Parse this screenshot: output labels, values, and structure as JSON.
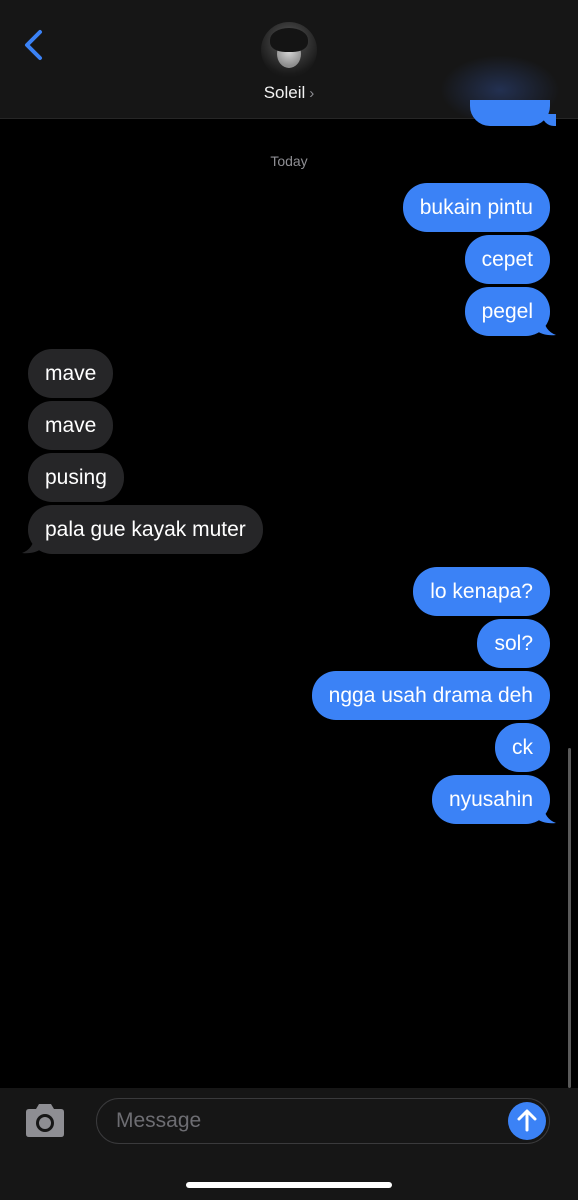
{
  "header": {
    "contact_name": "Soleil",
    "chevron": "›",
    "back_icon": "chevron-left-icon",
    "accent": "#3b82f6"
  },
  "thread": {
    "date_label": "Today",
    "messages": [
      {
        "direction": "sent",
        "text": "bukain pintu"
      },
      {
        "direction": "sent",
        "text": "cepet"
      },
      {
        "direction": "sent",
        "text": "pegel"
      },
      {
        "direction": "received",
        "text": "mave"
      },
      {
        "direction": "received",
        "text": "mave"
      },
      {
        "direction": "received",
        "text": "pusing"
      },
      {
        "direction": "received",
        "text": "pala gue kayak muter"
      },
      {
        "direction": "sent",
        "text": "lo kenapa?"
      },
      {
        "direction": "sent",
        "text": "sol?"
      },
      {
        "direction": "sent",
        "text": "ngga usah drama deh"
      },
      {
        "direction": "sent",
        "text": "ck"
      },
      {
        "direction": "sent",
        "text": "nyusahin"
      }
    ]
  },
  "composer": {
    "placeholder": "Message",
    "camera_icon": "camera-icon",
    "send_icon": "arrow-up-icon"
  },
  "colors": {
    "sent_bubble": "#3b82f6",
    "received_bubble": "#262628",
    "background": "#000000"
  }
}
